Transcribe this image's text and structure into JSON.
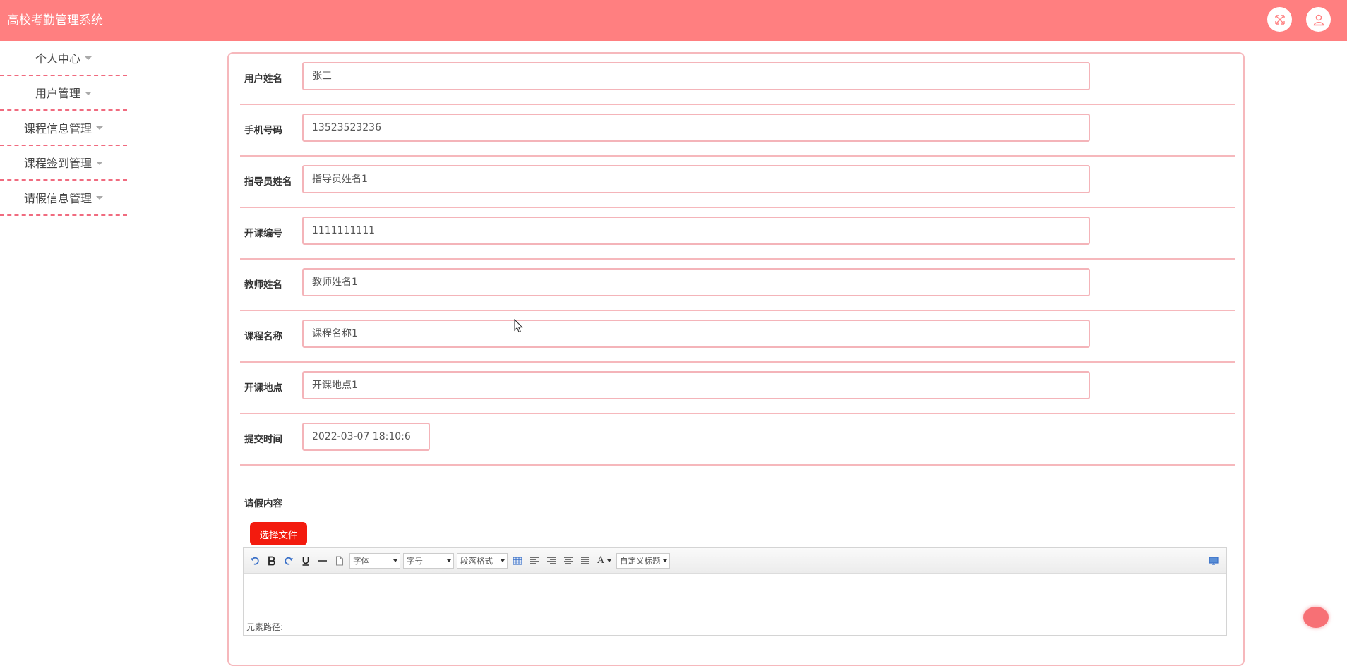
{
  "app": {
    "title": "高校考勤管理系统"
  },
  "header": {
    "fullscreen_icon": "expand-icon",
    "user_icon": "user-icon"
  },
  "sidebar": {
    "items": [
      {
        "label": "个人中心"
      },
      {
        "label": "用户管理"
      },
      {
        "label": "课程信息管理"
      },
      {
        "label": "课程签到管理"
      },
      {
        "label": "请假信息管理"
      }
    ]
  },
  "form": {
    "fields": [
      {
        "label": "用户姓名",
        "value": "张三"
      },
      {
        "label": "手机号码",
        "value": "13523523236"
      },
      {
        "label": "指导员姓名",
        "value": "指导员姓名1"
      },
      {
        "label": "开课编号",
        "value": "1111111111"
      },
      {
        "label": "教师姓名",
        "value": "教师姓名1"
      },
      {
        "label": "课程名称",
        "value": "课程名称1"
      },
      {
        "label": "开课地点",
        "value": "开课地点1"
      },
      {
        "label": "提交时间",
        "value": "2022-03-07 18:10:6"
      }
    ],
    "content_label": "请假内容",
    "upload_button": "选择文件"
  },
  "editor": {
    "font_select": "字体",
    "size_select": "字号",
    "paragraph_select": "段落格式",
    "font_color_label": "A",
    "custom_title_select": "自定义标题",
    "path_label": "元素路径:"
  },
  "colors": {
    "header": "#ff7f80",
    "accent": "#f31b0e",
    "border": "#f6b8bc"
  }
}
